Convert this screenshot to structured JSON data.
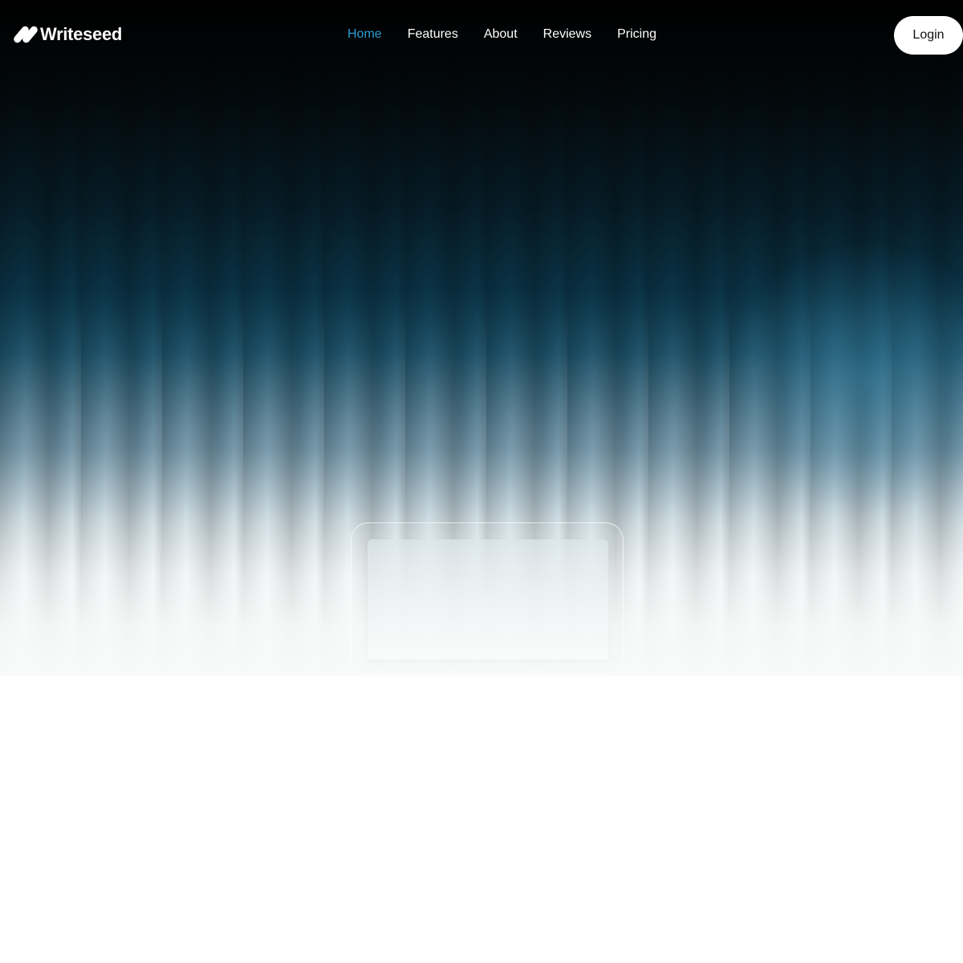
{
  "brand": {
    "name": "Writeseed",
    "accent_color": "#2b9fd1"
  },
  "nav": {
    "items": [
      {
        "label": "Home",
        "active": true
      },
      {
        "label": "Features",
        "active": false
      },
      {
        "label": "About",
        "active": false
      },
      {
        "label": "Reviews",
        "active": false
      },
      {
        "label": "Pricing",
        "active": false
      }
    ],
    "login_label": "Login"
  },
  "hero": {
    "background_top": "#000000",
    "background_glow": "#0a3346"
  }
}
